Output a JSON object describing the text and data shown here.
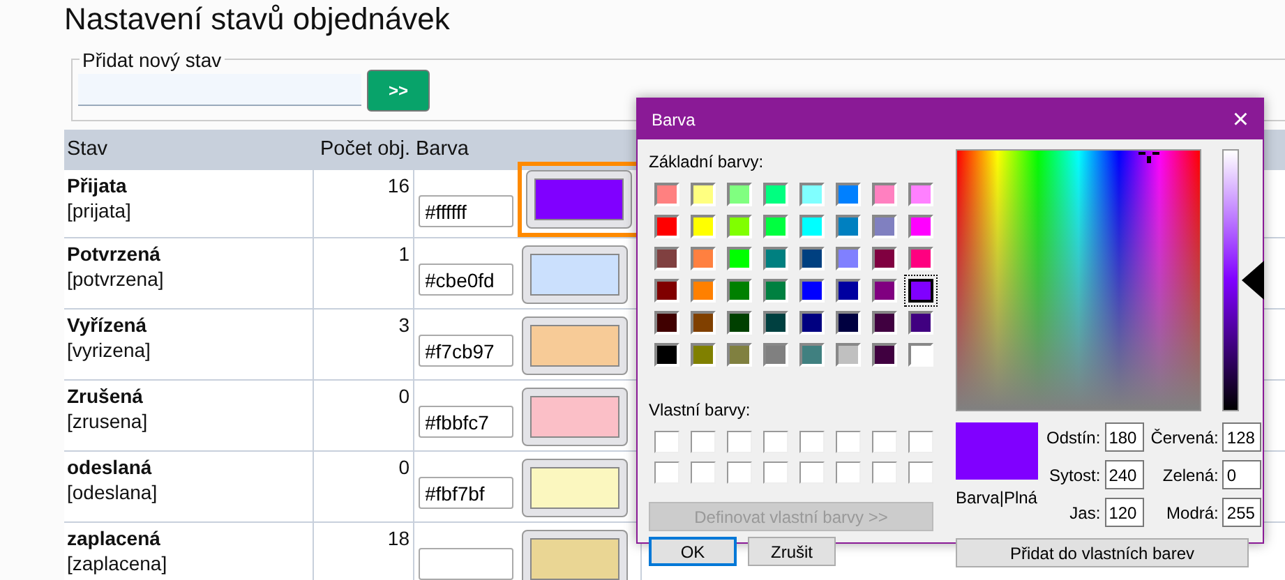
{
  "page_title": "Nastavení stavů objednávek",
  "add_state": {
    "legend": "Přidat nový stav",
    "button": ">>"
  },
  "table": {
    "columns": [
      "Stav",
      "Počet obj.",
      "Barva"
    ],
    "rows": [
      {
        "name": "Přijata",
        "code": "[prijata]",
        "count": "16",
        "hex": "#ffffff",
        "color": "#8000ff",
        "selected": true
      },
      {
        "name": "Potvrzená",
        "code": "[potvrzena]",
        "count": "1",
        "hex": "#cbe0fd",
        "color": "#cbe0fd",
        "selected": false
      },
      {
        "name": "Vyřízená",
        "code": "[vyrizena]",
        "count": "3",
        "hex": "#f7cb97",
        "color": "#f7cb97",
        "selected": false
      },
      {
        "name": "Zrušená",
        "code": "[zrusena]",
        "count": "0",
        "hex": "#fbbfc7",
        "color": "#fbbfc7",
        "selected": false
      },
      {
        "name": "odeslaná",
        "code": "[odeslana]",
        "count": "0",
        "hex": "#fbf7bf",
        "color": "#fbf7bf",
        "selected": false
      },
      {
        "name": "zaplacená",
        "code": "[zaplacena]",
        "count": "18",
        "color": "#ead694",
        "selected": false
      }
    ]
  },
  "dialog": {
    "title": "Barva",
    "close": "×",
    "basic_label": "Základní barvy:",
    "basic_colors": [
      {
        "color": "#ff8080",
        "selected": false
      },
      {
        "color": "#ffff80",
        "selected": false
      },
      {
        "color": "#80ff80",
        "selected": false
      },
      {
        "color": "#00ff80",
        "selected": false
      },
      {
        "color": "#80ffff",
        "selected": false
      },
      {
        "color": "#0080ff",
        "selected": false
      },
      {
        "color": "#ff80c0",
        "selected": false
      },
      {
        "color": "#ff80ff",
        "selected": false
      },
      {
        "color": "#ff0000",
        "selected": false
      },
      {
        "color": "#ffff00",
        "selected": false
      },
      {
        "color": "#80ff00",
        "selected": false
      },
      {
        "color": "#00ff40",
        "selected": false
      },
      {
        "color": "#00ffff",
        "selected": false
      },
      {
        "color": "#0080c0",
        "selected": false
      },
      {
        "color": "#8080c0",
        "selected": false
      },
      {
        "color": "#ff00ff",
        "selected": false
      },
      {
        "color": "#804040",
        "selected": false
      },
      {
        "color": "#ff8040",
        "selected": false
      },
      {
        "color": "#00ff00",
        "selected": false
      },
      {
        "color": "#008080",
        "selected": false
      },
      {
        "color": "#004080",
        "selected": false
      },
      {
        "color": "#8080ff",
        "selected": false
      },
      {
        "color": "#800040",
        "selected": false
      },
      {
        "color": "#ff0080",
        "selected": false
      },
      {
        "color": "#800000",
        "selected": false
      },
      {
        "color": "#ff8000",
        "selected": false
      },
      {
        "color": "#008000",
        "selected": false
      },
      {
        "color": "#008040",
        "selected": false
      },
      {
        "color": "#0000ff",
        "selected": false
      },
      {
        "color": "#0000a0",
        "selected": false
      },
      {
        "color": "#800080",
        "selected": false
      },
      {
        "color": "#8000ff",
        "selected": true
      },
      {
        "color": "#400000",
        "selected": false
      },
      {
        "color": "#804000",
        "selected": false
      },
      {
        "color": "#004000",
        "selected": false
      },
      {
        "color": "#004040",
        "selected": false
      },
      {
        "color": "#000080",
        "selected": false
      },
      {
        "color": "#000040",
        "selected": false
      },
      {
        "color": "#400040",
        "selected": false
      },
      {
        "color": "#400080",
        "selected": false
      },
      {
        "color": "#000000",
        "selected": false
      },
      {
        "color": "#808000",
        "selected": false
      },
      {
        "color": "#808040",
        "selected": false
      },
      {
        "color": "#808080",
        "selected": false
      },
      {
        "color": "#408080",
        "selected": false
      },
      {
        "color": "#c0c0c0",
        "selected": false
      },
      {
        "color": "#400040",
        "selected": false
      },
      {
        "color": "#ffffff",
        "selected": false
      }
    ],
    "custom_label": "Vlastní barvy:",
    "define_button": {
      "label": "Definovat vlastní barvy >>",
      "disabled": true
    },
    "ok": "OK",
    "cancel": "Zrušit",
    "luminance": {
      "level": 0.5
    },
    "preview_label": "Barva|Plná",
    "fields": [
      {
        "label": "Odstín:",
        "value": "180"
      },
      {
        "label": "Červená:",
        "value": "128"
      },
      {
        "label": "Sytost:",
        "value": "240"
      },
      {
        "label": "Zelená:",
        "value": "0"
      },
      {
        "label": "Jas:",
        "value": "120"
      },
      {
        "label": "Modrá:",
        "value": "255"
      }
    ],
    "add_custom": "Přidat do vlastních barev"
  }
}
